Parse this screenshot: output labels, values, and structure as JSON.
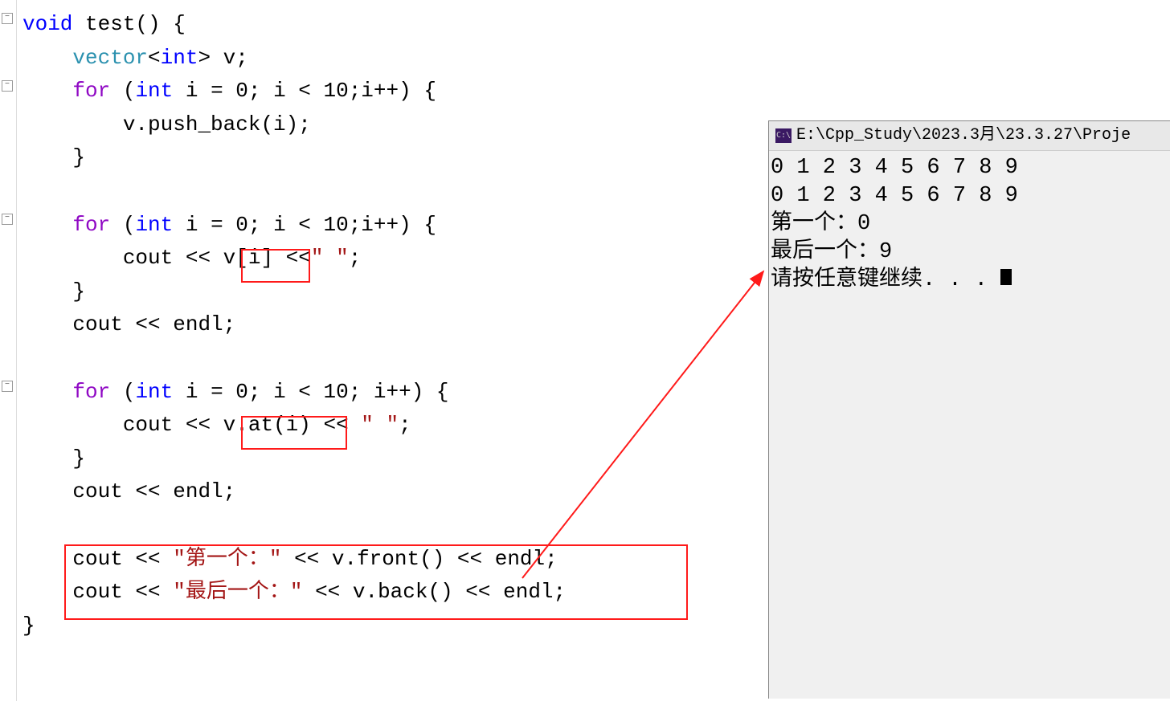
{
  "code": {
    "l1": {
      "kvoid": "void",
      "fn": " test() {"
    },
    "l2": {
      "ind": "    ",
      "kvec": "vector",
      "lt": "<",
      "kint": "int",
      "gt": ">",
      "rest": " v;"
    },
    "l3": {
      "ind": "    ",
      "kfor": "for",
      "sp": " (",
      "kint": "int",
      "rest": " i = 0; i < 10;i++) {"
    },
    "l4": {
      "ind": "        ",
      "rest": "v.push_back(i);"
    },
    "l5": {
      "ind": "    ",
      "rest": "}"
    },
    "l6": "",
    "l7": {
      "ind": "    ",
      "kfor": "for",
      "sp": " (",
      "kint": "int",
      "rest": " i = 0; i < 10;i++) {"
    },
    "l8": {
      "ind": "        ",
      "c1": "cout << ",
      "hl": "v[i]",
      "c2": " <<",
      "s": "\" \"",
      "c3": ";"
    },
    "l9": {
      "ind": "    ",
      "rest": "}"
    },
    "l10": {
      "ind": "    ",
      "rest": "cout << endl;"
    },
    "l11": "",
    "l12": {
      "ind": "    ",
      "kfor": "for",
      "sp": " (",
      "kint": "int",
      "rest": " i = 0; i < 10; i++) {"
    },
    "l13": {
      "ind": "        ",
      "c1": "cout << ",
      "hl": "v.at(i)",
      "c2": " << ",
      "s": "\" \"",
      "c3": ";"
    },
    "l14": {
      "ind": "    ",
      "rest": "}"
    },
    "l15": {
      "ind": "    ",
      "rest": "cout << endl;"
    },
    "l16": "",
    "l17": {
      "ind": "    ",
      "c1": "cout << ",
      "s": "\"第一个：\"",
      "c2": " << v.front() << endl;"
    },
    "l18": {
      "ind": "    ",
      "c1": "cout << ",
      "s": "\"最后一个：\"",
      "c2": " << v.back() << endl;"
    },
    "l19": "}"
  },
  "console": {
    "icon_text": "C:\\",
    "title": "E:\\Cpp_Study\\2023.3月\\23.3.27\\Proje",
    "line1": "0 1 2 3 4 5 6 7 8 9",
    "line2": "0 1 2 3 4 5 6 7 8 9",
    "line3": "第一个：0",
    "line4": "最后一个：9",
    "line5": "请按任意键继续. . . "
  }
}
